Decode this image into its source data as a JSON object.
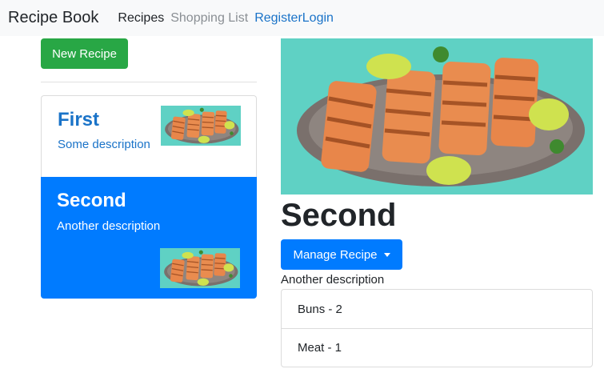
{
  "navbar": {
    "brand": "Recipe Book",
    "links": [
      "Recipes",
      "Shopping List",
      "Register",
      "Login"
    ]
  },
  "sidebar": {
    "new_recipe_label": "New Recipe",
    "recipes": [
      {
        "name": "First",
        "description": "Some description"
      },
      {
        "name": "Second",
        "description": "Another description"
      }
    ]
  },
  "detail": {
    "title": "Second",
    "manage_label": "Manage Recipe",
    "description": "Another description",
    "ingredients": [
      "Buns - 2",
      "Meat - 1"
    ]
  },
  "colors": {
    "navbar_bg": "#f8f9fa",
    "new_button": "#28a745",
    "primary": "#007bff",
    "link": "#1a73c8",
    "image_bg": "#5fd1c4",
    "salmon": "#e8864a",
    "lime": "#b6d94a"
  },
  "icons": [
    "salmon-photo",
    "caret-down-icon"
  ]
}
